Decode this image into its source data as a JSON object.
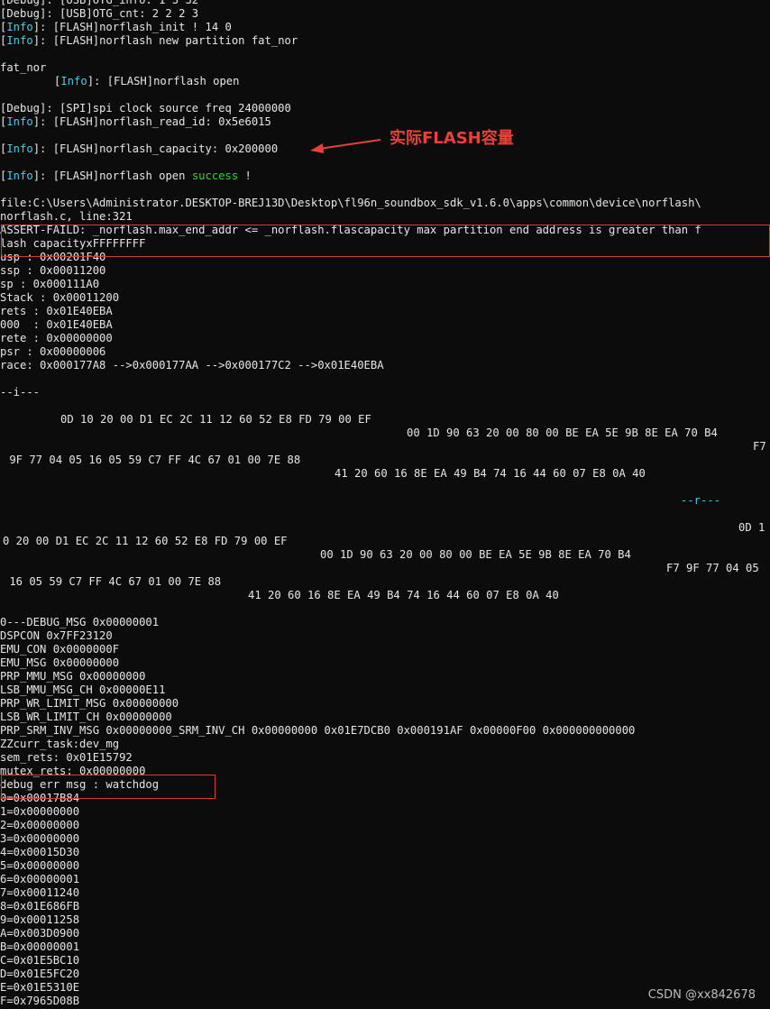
{
  "lines": {
    "l01": "[Debug]: [USB]OTG_info: 1 3 32",
    "l02": "[Debug]: [USB]OTG_cnt: 2 2 2 3",
    "l03_tag": "Info",
    "l03_text": ": [FLASH]norflash_init ! 14 0",
    "l04_tag": "Info",
    "l04_text": ": [FLASH]norflash new partition fat_nor",
    "l06": "fat_nor",
    "l07_tag": "Info",
    "l07_text": ": [FLASH]norflash open",
    "l09": "[Debug]: [SPI]spi clock source freq 24000000",
    "l10_tag": "Info",
    "l10_text": ": [FLASH]norflash_read_id: 0x5e6015",
    "l12_tag": "Info",
    "l12_text": ": [FLASH]norflash_capacity: 0x200000",
    "l14_tag": "Info",
    "l14_text": ": [FLASH]norflash open ",
    "l14_success": "success",
    "l14_tail": " !",
    "l16": "file:C:\\Users\\Administrator.DESKTOP-BREJ13D\\Desktop\\fl96n_soundbox_sdk_v1.6.0\\apps\\common\\device\\norflash\\",
    "l17": "norflash.c, line:321",
    "l18": "ASSERT-FAILD: _norflash.max_end_addr <= _norflash.flascapacity max partition end address is greater than f",
    "l19": "lash capacityxFFFFFFFF",
    "l20": "usp : 0x00201F40",
    "l21": "ssp : 0x00011200",
    "l22": "sp : 0x000111A0",
    "l23": "Stack : 0x00011200",
    "l24": "rets : 0x01E40EBA",
    "l25": "000  : 0x01E40EBA",
    "l26": "rete : 0x00000000",
    "l27": "psr : 0x00000006",
    "l28": "race: 0x000177A8 -->0x000177AA -->0x000177C2 -->0x01E40EBA",
    "l30": "--i---",
    "h1a": "0D 10 20 00 D1 EC 2C 11 12 60 52 E8 FD 79 00 EF",
    "h1b": "00 1D 90 63 20 00 80 00 BE EA 5E 9B 8E EA 70 B4",
    "h1c": "F7",
    "h1d": " 9F 77 04 05 16 05 59 C7 FF 4C 67 01 00 7E 88",
    "h1e": "41 20 60 16 8E EA 49 B4 74 16 44 60 07 E8 0A 40",
    "r_sep": "--r---",
    "h2a": "0D 1",
    "h2b": "0 20 00 D1 EC 2C 11 12 60 52 E8 FD 79 00 EF",
    "h2c": "00 1D 90 63 20 00 80 00 BE EA 5E 9B 8E EA 70 B4",
    "h2d": "F7 9F 77 04 05",
    "h2e": " 16 05 59 C7 FF 4C 67 01 00 7E 88",
    "h2f": "41 20 60 16 8E EA 49 B4 74 16 44 60 07 E8 0A 40",
    "d01": "0---DEBUG_MSG 0x00000001",
    "d02": "DSPCON 0x7FF23120",
    "d03": "EMU_CON 0x0000000F",
    "d04": "EMU_MSG 0x00000000",
    "d05": "PRP_MMU_MSG 0x00000000",
    "d06": "LSB_MMU_MSG_CH 0x00000E11",
    "d07": "PRP_WR_LIMIT_MSG 0x00000000",
    "d08": "LSB_WR_LIMIT_CH 0x00000000",
    "d09": "PRP_SRM_INV_MSG 0x00000000_SRM_INV_CH 0x00000000 0x01E7DCB0 0x000191AF 0x00000F00 0x000000000000",
    "d10": "ZZcurr_task:dev_mg",
    "d11": "sem_rets: 0x01E15792",
    "d12": "mutex_rets: 0x00000000",
    "d13": "debug err msg : watchdog",
    "r0": "0=0x00017B84",
    "r1": "1=0x00000000",
    "r2": "2=0x00000000",
    "r3": "3=0x00000000",
    "r4": "4=0x00015D30",
    "r5": "5=0x00000000",
    "r6": "6=0x00000001",
    "r7": "7=0x00011240",
    "r8": "8=0x01E686FB",
    "r9": "9=0x00011258",
    "rA": "A=0x003D0900",
    "rB": "B=0x00000001",
    "rC": "C=0x01E5BC10",
    "rD": "D=0x01E5FC20",
    "rE": "E=0x01E5310E",
    "rF": "F=0x7965D08B"
  },
  "annotation": {
    "text": "实际FLASH容量"
  },
  "watermark": {
    "text": "CSDN @xx842678"
  },
  "colors": {
    "background": "#0c0c0c",
    "text": "#e6e6e6",
    "info_tag": "#4ec9e6",
    "success": "#2fd52f",
    "annotation_red": "#e8413b",
    "highlight_box": "#d93a3a"
  }
}
